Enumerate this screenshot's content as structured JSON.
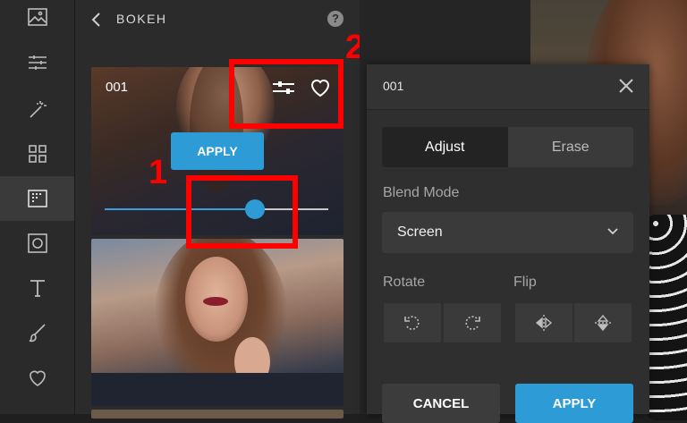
{
  "toolbar": {
    "items": [
      {
        "icon": "image-icon"
      },
      {
        "icon": "sliders-icon"
      },
      {
        "icon": "magic-wand-icon"
      },
      {
        "icon": "grid-icon"
      },
      {
        "icon": "texture-icon",
        "active": true
      },
      {
        "icon": "frame-icon"
      },
      {
        "icon": "text-icon"
      },
      {
        "icon": "brush-icon"
      },
      {
        "icon": "heart-icon"
      }
    ]
  },
  "panel": {
    "title": "BOKEH",
    "help": "?",
    "thumbnail": {
      "name": "001",
      "apply_label": "APPLY",
      "slider_value_fraction": 0.67
    }
  },
  "annotations": {
    "box1": "1",
    "box2": "2",
    "color": "#ff0000"
  },
  "modal": {
    "title": "001",
    "tabs": [
      {
        "label": "Adjust",
        "active": true
      },
      {
        "label": "Erase",
        "active": false
      }
    ],
    "blend_mode": {
      "label": "Blend Mode",
      "value": "Screen"
    },
    "rotate": {
      "label": "Rotate"
    },
    "flip": {
      "label": "Flip"
    },
    "cancel_label": "CANCEL",
    "apply_label": "APPLY"
  },
  "colors": {
    "accent": "#2c9bd6",
    "panel_bg": "#2b2b2b",
    "modal_bg": "#2f2f2f"
  }
}
